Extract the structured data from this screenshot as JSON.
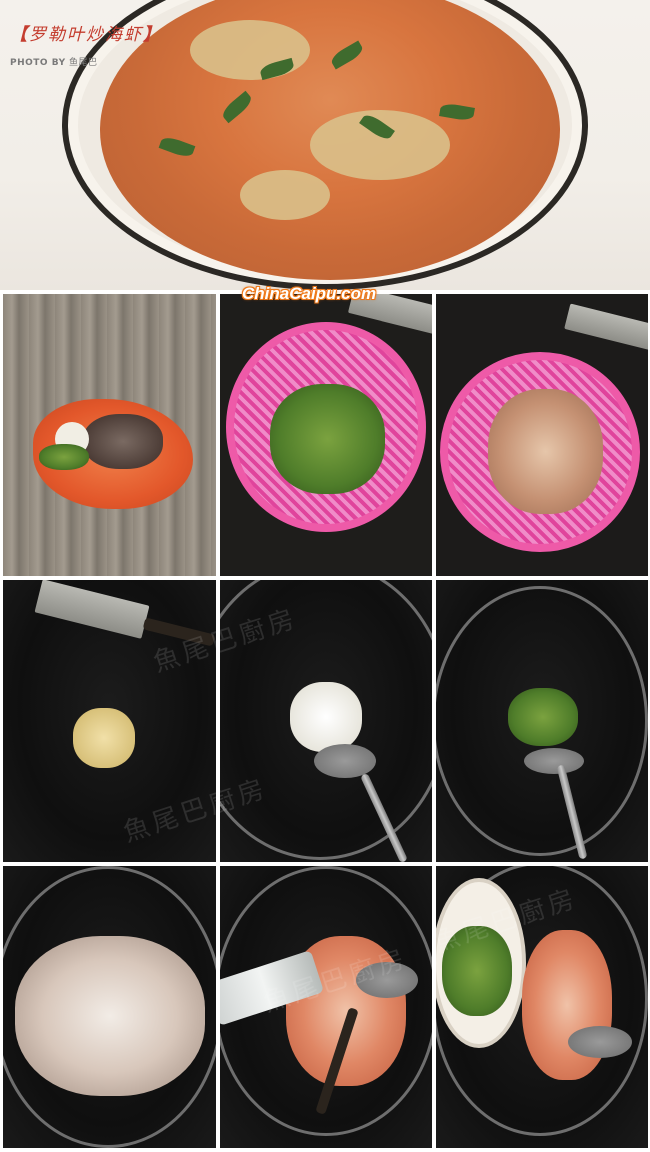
{
  "header": {
    "title": "罗勒叶炒海虾",
    "open_bracket": "【",
    "close_bracket": "】",
    "credit_prefix": "PHOTO BY",
    "credit_name": "鱼尾巴"
  },
  "watermark": {
    "site": "ChinaCaipu.com",
    "overlay": "魚尾巴廚房"
  },
  "steps": [
    {
      "name": "ingredients-bag"
    },
    {
      "name": "basil-leaves-in-basket"
    },
    {
      "name": "shrimp-in-basket"
    },
    {
      "name": "minced-garlic-in-wok"
    },
    {
      "name": "frying-garlic"
    },
    {
      "name": "adding-basil"
    },
    {
      "name": "adding-shrimp"
    },
    {
      "name": "pouring-wine"
    },
    {
      "name": "adding-greens"
    }
  ],
  "colors": {
    "title_red": "#c43d2f",
    "watermark_orange": "#f07a1a",
    "basket_pink": "#ee5aa8"
  }
}
